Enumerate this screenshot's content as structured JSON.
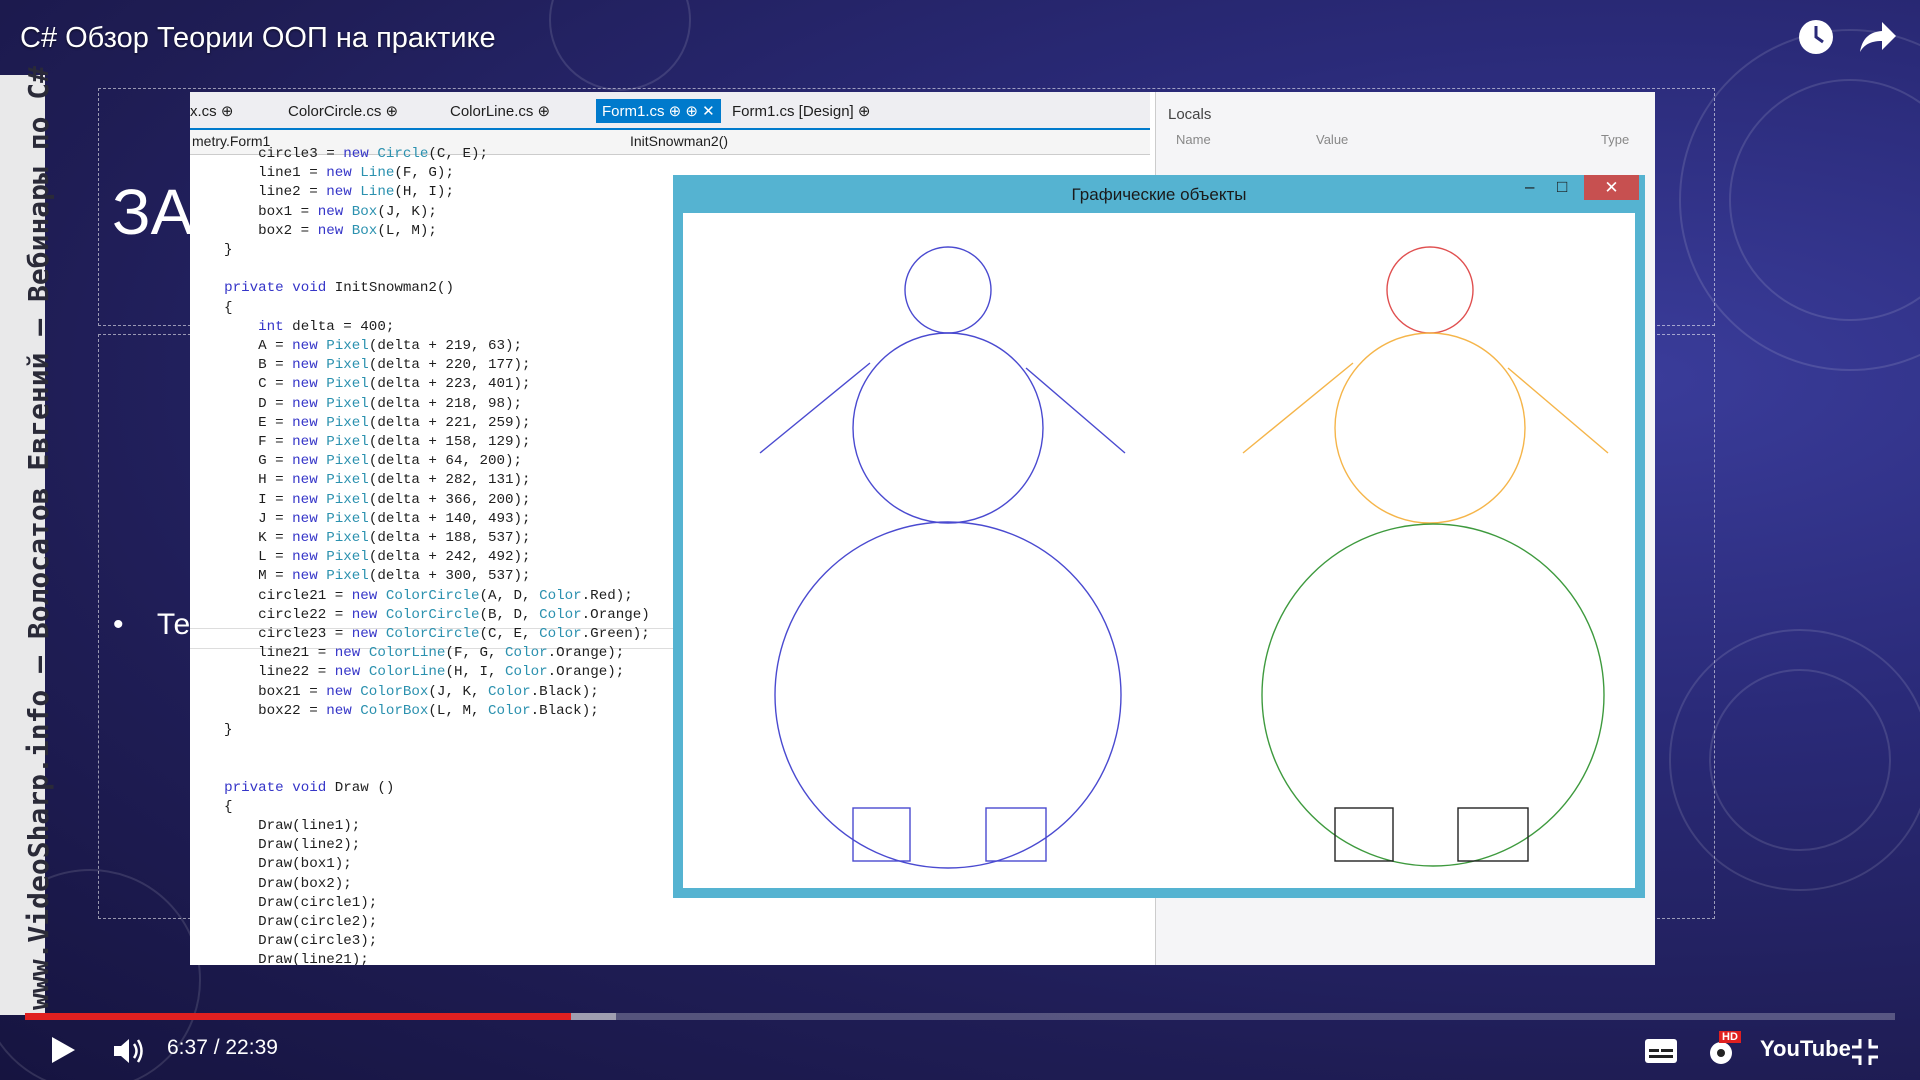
{
  "video": {
    "title": "C# Обзор Теории ООП на практике",
    "watermark": "www.VideoSharp.info — Волосатов Евгений — Вебинары по C#",
    "time_current": "6:37",
    "time_total": "22:39",
    "time_display": "6:37 / 22:39",
    "progress_fraction": 0.292,
    "buffered_fraction": 0.316,
    "youtube_logo": "YouTube",
    "hd_badge": "HD"
  },
  "slide": {
    "heading": "ЗА",
    "bullet": "Те"
  },
  "ide": {
    "tabs": [
      {
        "label": "x.cs ⊕"
      },
      {
        "label": "ColorCircle.cs ⊕"
      },
      {
        "label": "ColorLine.cs ⊕"
      },
      {
        "label": "Form1.cs ⊕ ⊕ ✕"
      },
      {
        "label": "Form1.cs [Design] ⊕"
      }
    ],
    "nav_class": "metry.Form1",
    "nav_member": "InitSnowman2()",
    "locals_title": "Locals",
    "locals_columns": [
      "Name",
      "Value",
      "Type"
    ],
    "code_lines": [
      "        circle3 = new Circle(C, E);",
      "        line1 = new Line(F, G);",
      "        line2 = new Line(H, I);",
      "        box1 = new Box(J, K);",
      "        box2 = new Box(L, M);",
      "    }",
      "",
      "    private void InitSnowman2()",
      "    {",
      "        int delta = 400;",
      "        A = new Pixel(delta + 219, 63);",
      "        B = new Pixel(delta + 220, 177);",
      "        C = new Pixel(delta + 223, 401);",
      "        D = new Pixel(delta + 218, 98);",
      "        E = new Pixel(delta + 221, 259);",
      "        F = new Pixel(delta + 158, 129);",
      "        G = new Pixel(delta + 64, 200);",
      "        H = new Pixel(delta + 282, 131);",
      "        I = new Pixel(delta + 366, 200);",
      "        J = new Pixel(delta + 140, 493);",
      "        K = new Pixel(delta + 188, 537);",
      "        L = new Pixel(delta + 242, 492);",
      "        M = new Pixel(delta + 300, 537);",
      "        circle21 = new ColorCircle(A, D, Color.Red);",
      "        circle22 = new ColorCircle(B, D, Color.Orange)",
      "        circle23 = new ColorCircle(C, E, Color.Green);",
      "        line21 = new ColorLine(F, G, Color.Orange);",
      "        line22 = new ColorLine(H, I, Color.Orange);",
      "        box21 = new ColorBox(J, K, Color.Black);",
      "        box22 = new ColorBox(L, M, Color.Black);",
      "    }",
      "",
      "",
      "    private void Draw ()",
      "    {",
      "        Draw(line1);",
      "        Draw(line2);",
      "        Draw(box1);",
      "        Draw(box2);",
      "        Draw(circle1);",
      "        Draw(circle2);",
      "        Draw(circle3);",
      "        Draw(line21);"
    ]
  },
  "window": {
    "title": "Графические объекты",
    "close": "✕",
    "minimize": "–",
    "maximize": "□"
  },
  "colors": {
    "blue_snowman": "#4a4ad0",
    "red": "#e05050",
    "orange": "#f5b54a",
    "green": "#3e9a3e",
    "black": "#222222",
    "keyword": "#3535c8",
    "type": "#2b91af",
    "window_frame": "#55b3d1",
    "progress": "#e02020"
  },
  "icons": [
    "clock-icon",
    "share-icon",
    "play-icon",
    "volume-icon",
    "subtitles-icon",
    "settings-icon",
    "fullscreen-exit-icon"
  ]
}
